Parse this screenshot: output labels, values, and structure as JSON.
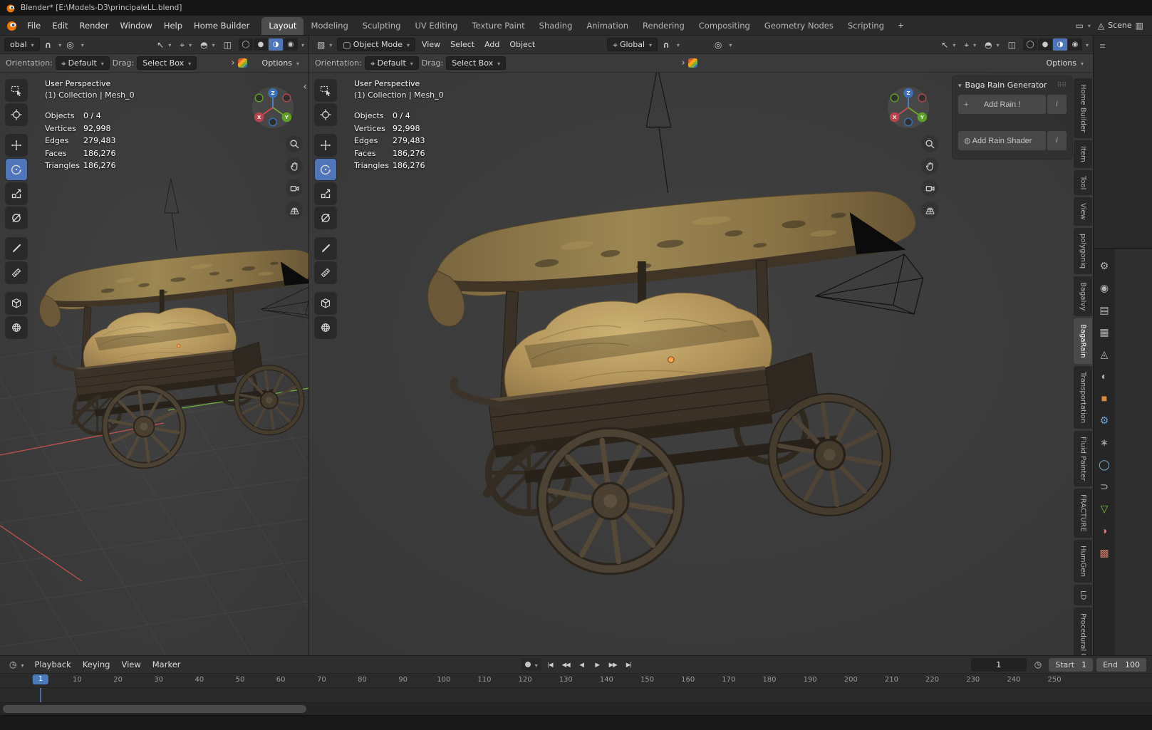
{
  "titlebar": {
    "title": "Blender* [E:\\Models-D3\\principaleLL.blend]"
  },
  "menubar": {
    "menus": [
      "File",
      "Edit",
      "Render",
      "Window",
      "Help",
      "Home Builder"
    ],
    "workspaces": [
      "Layout",
      "Modeling",
      "Sculpting",
      "UV Editing",
      "Texture Paint",
      "Shading",
      "Animation",
      "Rendering",
      "Compositing",
      "Geometry Nodes",
      "Scripting"
    ],
    "active_workspace": "Layout",
    "add_workspace_label": "+",
    "scene_name": "Scene"
  },
  "viewport": {
    "header": {
      "mode": "Object Mode",
      "menus": [
        "View",
        "Select",
        "Add",
        "Object"
      ],
      "orientation": "Global",
      "orientation_truncated": "obal",
      "shading_modes": [
        {
          "name": "wireframe",
          "glyph": "◯"
        },
        {
          "name": "solid",
          "glyph": "●"
        },
        {
          "name": "material",
          "glyph": "◑"
        },
        {
          "name": "rendered",
          "glyph": "◉"
        }
      ],
      "active_shading": "material"
    },
    "tool_settings": {
      "orientation_label": "Orientation:",
      "orientation_value": "Default",
      "drag_label": "Drag:",
      "drag_value": "Select Box",
      "options_label": "Options"
    },
    "overlay": {
      "perspective": "User Perspective",
      "collection": "(1) Collection | Mesh_0",
      "stats": [
        {
          "label": "Objects",
          "value": "0 / 4"
        },
        {
          "label": "Vertices",
          "value": "92,998"
        },
        {
          "label": "Edges",
          "value": "279,483"
        },
        {
          "label": "Faces",
          "value": "186,276"
        },
        {
          "label": "Triangles",
          "value": "186,276"
        }
      ]
    },
    "gizmo_axes": {
      "x": "X",
      "y": "Y",
      "z": "Z"
    },
    "tools": [
      {
        "name": "select-box",
        "icon": "tool-select-box"
      },
      {
        "name": "cursor",
        "icon": "tool-cursor"
      },
      {
        "name": "move",
        "icon": "tool-move"
      },
      {
        "name": "rotate",
        "icon": "tool-rotate"
      },
      {
        "name": "scale",
        "icon": "tool-scale"
      },
      {
        "name": "transform",
        "icon": "tool-transform"
      },
      {
        "name": "annotate",
        "icon": "tool-annotate"
      },
      {
        "name": "measure",
        "icon": "tool-measure"
      },
      {
        "name": "add-cube",
        "icon": "tool-add-cube"
      },
      {
        "name": "primitive-sphere",
        "icon": "tool-sphere"
      }
    ],
    "active_tool": "rotate"
  },
  "side_panel": {
    "title": "Baga Rain Generator",
    "buttons": [
      {
        "icon_glyph": "+",
        "label": "Add Rain !",
        "info": "i"
      },
      {
        "icon_glyph": "◍",
        "label": "Add Rain Shader",
        "info": "i"
      }
    ],
    "tabs": [
      "Home Builder",
      "Item",
      "Tool",
      "View",
      "polygoniq",
      "BagaIvy",
      "BagaRain",
      "Transportation",
      "Fluid Painter",
      "FRACTURE",
      "HumGen",
      "LD",
      "Procedural Cro"
    ],
    "active_tab": "BagaRain"
  },
  "properties_rail": {
    "icons": [
      {
        "name": "active-tool",
        "glyph": "⚙",
        "color": "#b4b4b4"
      },
      {
        "name": "render",
        "glyph": "◉",
        "color": "#b4b4b4"
      },
      {
        "name": "output",
        "glyph": "▤",
        "color": "#b4b4b4"
      },
      {
        "name": "view-layer",
        "glyph": "▦",
        "color": "#b4b4b4"
      },
      {
        "name": "scene",
        "glyph": "◬",
        "color": "#b4b4b4"
      },
      {
        "name": "world",
        "glyph": "◐",
        "color": "#b4b4b4"
      },
      {
        "name": "object",
        "glyph": "■",
        "color": "#dd8a3c"
      },
      {
        "name": "modifiers",
        "glyph": "⚙",
        "color": "#6ea7d9"
      },
      {
        "name": "particles",
        "glyph": "∗",
        "color": "#b4b4b4"
      },
      {
        "name": "physics",
        "glyph": "◯",
        "color": "#7fb3d6"
      },
      {
        "name": "constraints",
        "glyph": "⊃",
        "color": "#b4b4b4"
      },
      {
        "name": "object-data",
        "glyph": "▽",
        "color": "#7fc24a"
      },
      {
        "name": "material",
        "glyph": "◑",
        "color": "#d77f7f"
      },
      {
        "name": "texture",
        "glyph": "▩",
        "color": "#cf7a68"
      }
    ]
  },
  "timeline": {
    "menus": [
      "Playback",
      "Keying",
      "View",
      "Marker"
    ],
    "transport": [
      "|◀",
      "◀◀",
      "◀",
      "▶",
      "▶▶",
      "▶|"
    ],
    "frame_current": "1",
    "start_label": "Start",
    "start_value": "1",
    "end_label": "End",
    "end_value": "100",
    "playhead": "1",
    "ruler": [
      "1",
      "10",
      "20",
      "30",
      "40",
      "50",
      "60",
      "70",
      "80",
      "90",
      "100",
      "110",
      "120",
      "130",
      "140",
      "150",
      "160",
      "170",
      "180",
      "190",
      "200",
      "210",
      "220",
      "230",
      "240",
      "250"
    ]
  }
}
